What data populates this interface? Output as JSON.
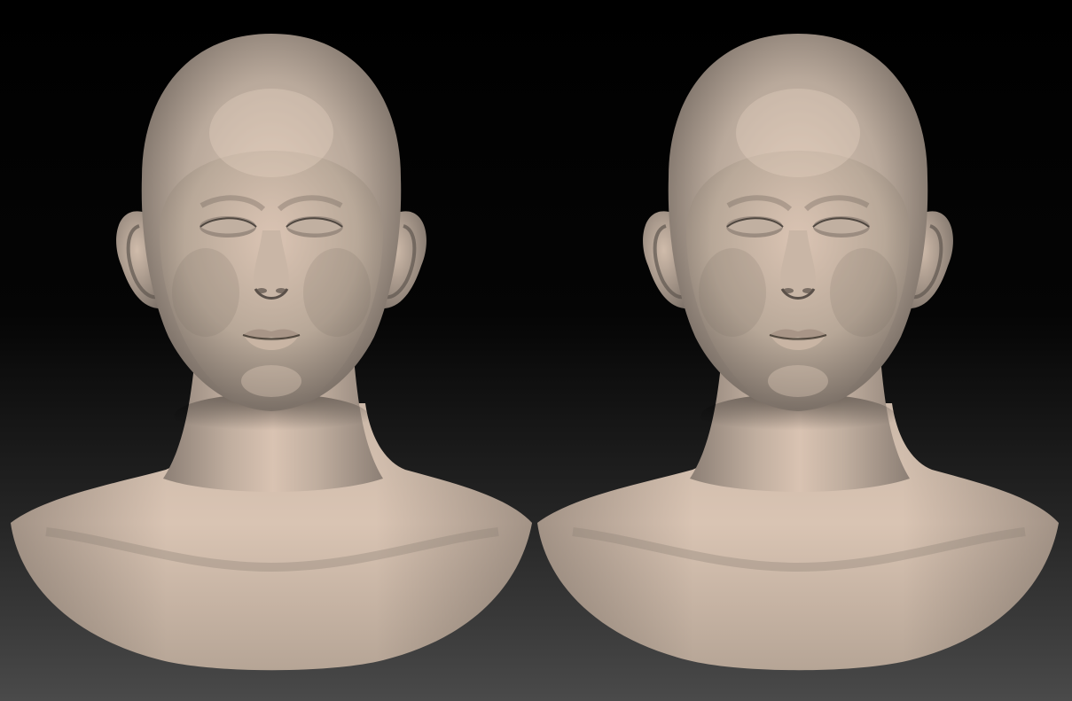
{
  "scene": {
    "background_top": "#000000",
    "background_bottom": "#4a4a4a",
    "clay_light": "#d8c3b2",
    "clay_mid": "#b3a395",
    "clay_dark": "#6f655d",
    "models": [
      {
        "id": "head-sculpt-left",
        "variant": "version-a"
      },
      {
        "id": "head-sculpt-right",
        "variant": "version-b"
      }
    ]
  }
}
